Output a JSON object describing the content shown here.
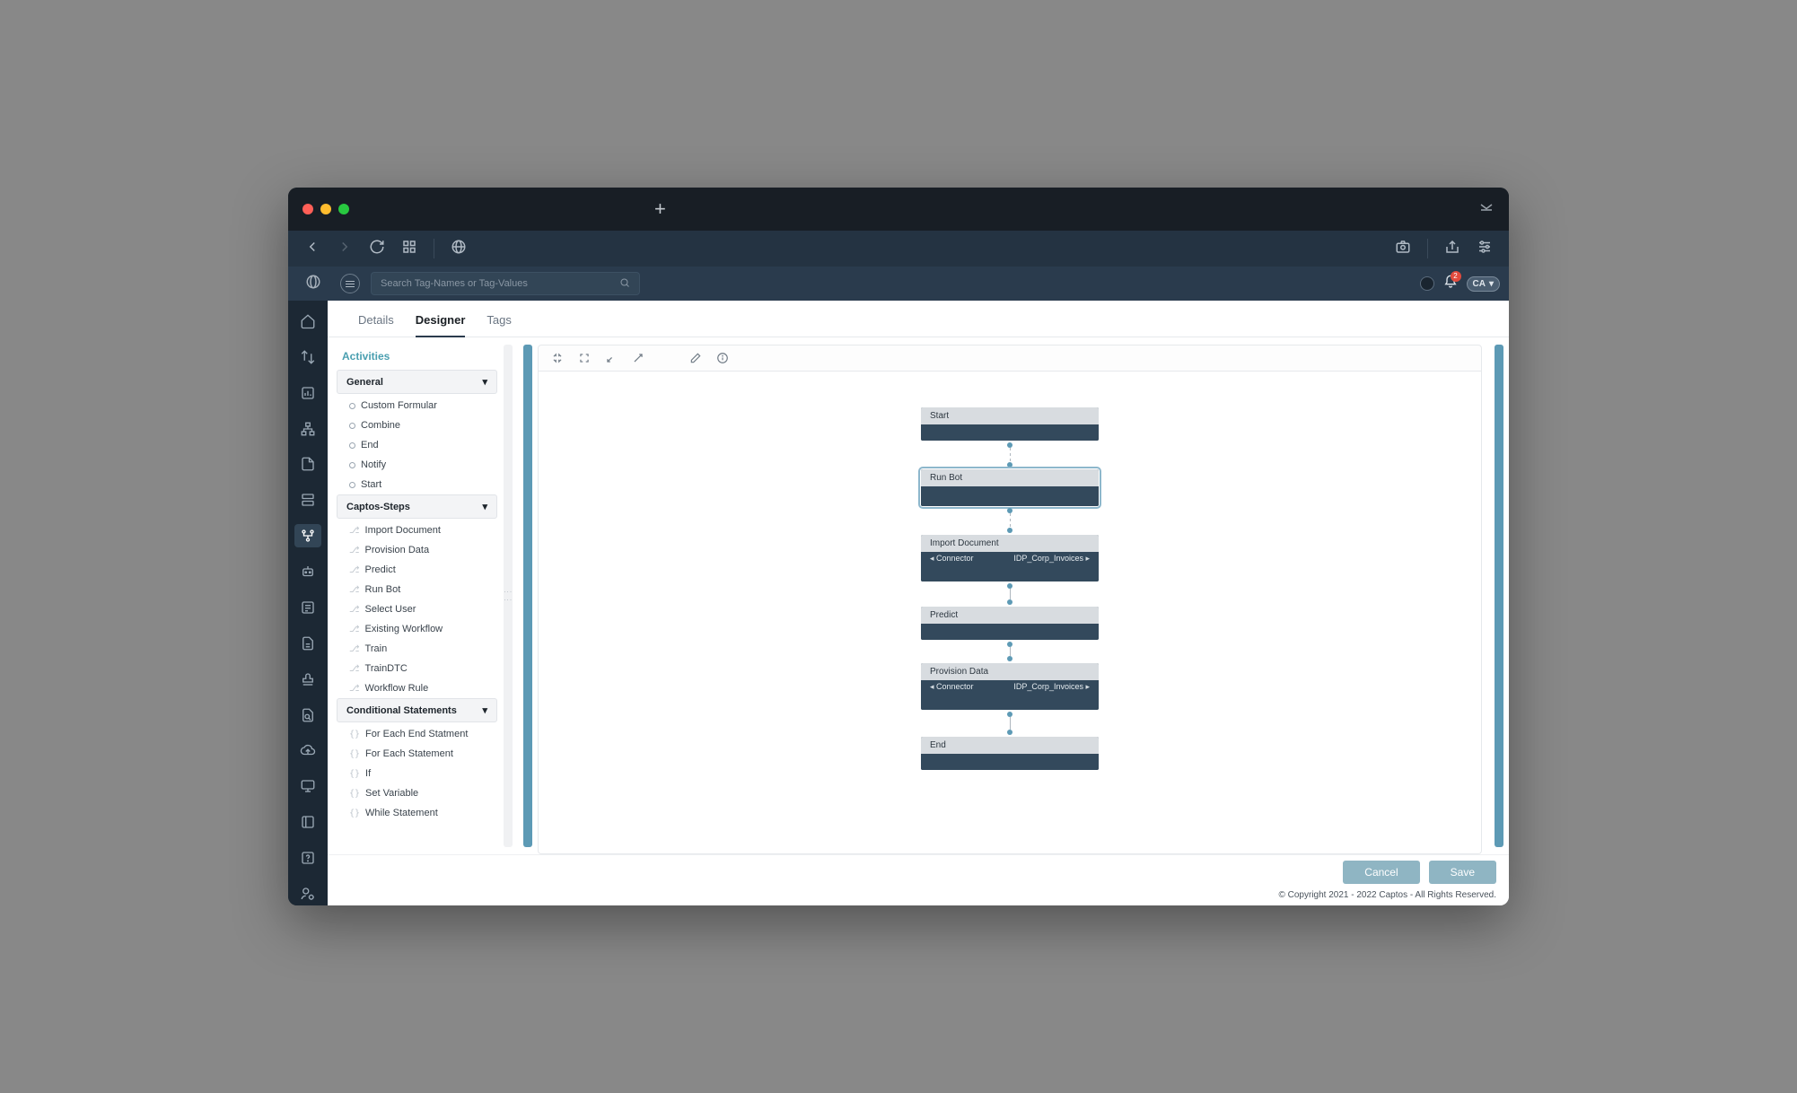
{
  "header": {
    "search_placeholder": "Search Tag-Names or Tag-Values",
    "notification_count": "2",
    "user_initials": "CA"
  },
  "tabs": [
    "Details",
    "Designer",
    "Tags"
  ],
  "active_tab": "Designer",
  "activities_title": "Activities",
  "sections": {
    "general": {
      "label": "General",
      "items": [
        "Custom Formular",
        "Combine",
        "End",
        "Notify",
        "Start"
      ]
    },
    "captos": {
      "label": "Captos-Steps",
      "items": [
        "Import Document",
        "Provision Data",
        "Predict",
        "Run Bot",
        "Select User",
        "Existing Workflow",
        "Train",
        "TrainDTC",
        "Workflow Rule"
      ]
    },
    "conditional": {
      "label": "Conditional Statements",
      "items": [
        "For Each End Statment",
        "For Each Statement",
        "If",
        "Set Variable",
        "While Statement"
      ]
    }
  },
  "nodes": {
    "start": {
      "title": "Start"
    },
    "runbot": {
      "title": "Run Bot"
    },
    "import": {
      "title": "Import Document",
      "prop_label": "Connector",
      "prop_value": "IDP_Corp_Invoices"
    },
    "predict": {
      "title": "Predict"
    },
    "provision": {
      "title": "Provision Data",
      "prop_label": "Connector",
      "prop_value": "IDP_Corp_Invoices"
    },
    "end": {
      "title": "End"
    }
  },
  "buttons": {
    "cancel": "Cancel",
    "save": "Save"
  },
  "copyright": "© Copyright 2021 - 2022 Captos - All Rights Reserved."
}
